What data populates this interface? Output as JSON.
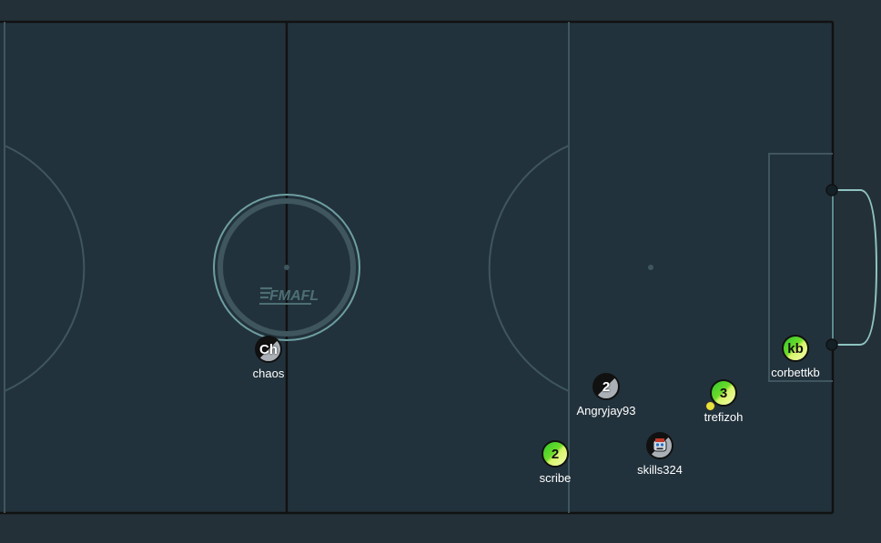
{
  "game": {
    "logo_text": "FMAFL",
    "colors": {
      "background": "#233038",
      "field": "#22323c",
      "line": "#111111",
      "faint_line": "#3f565e",
      "circle": "#6e9fa2",
      "goal": "#8fc3c0",
      "red_team": "#111111",
      "blue_team": "#6edb2a",
      "ball": "#e8e23a"
    }
  },
  "players": [
    {
      "name": "chaos",
      "avatar": "Ch",
      "team": "red"
    },
    {
      "name": "Angryjay93",
      "avatar": "2",
      "team": "red"
    },
    {
      "name": "skills324",
      "avatar": "",
      "avatar_icon": "robot-face-icon",
      "team": "red"
    },
    {
      "name": "scribe",
      "avatar": "2",
      "team": "blue"
    },
    {
      "name": "trefizoh",
      "avatar": "3",
      "team": "blue"
    },
    {
      "name": "corbettkb",
      "avatar": "kb",
      "team": "blue"
    }
  ]
}
